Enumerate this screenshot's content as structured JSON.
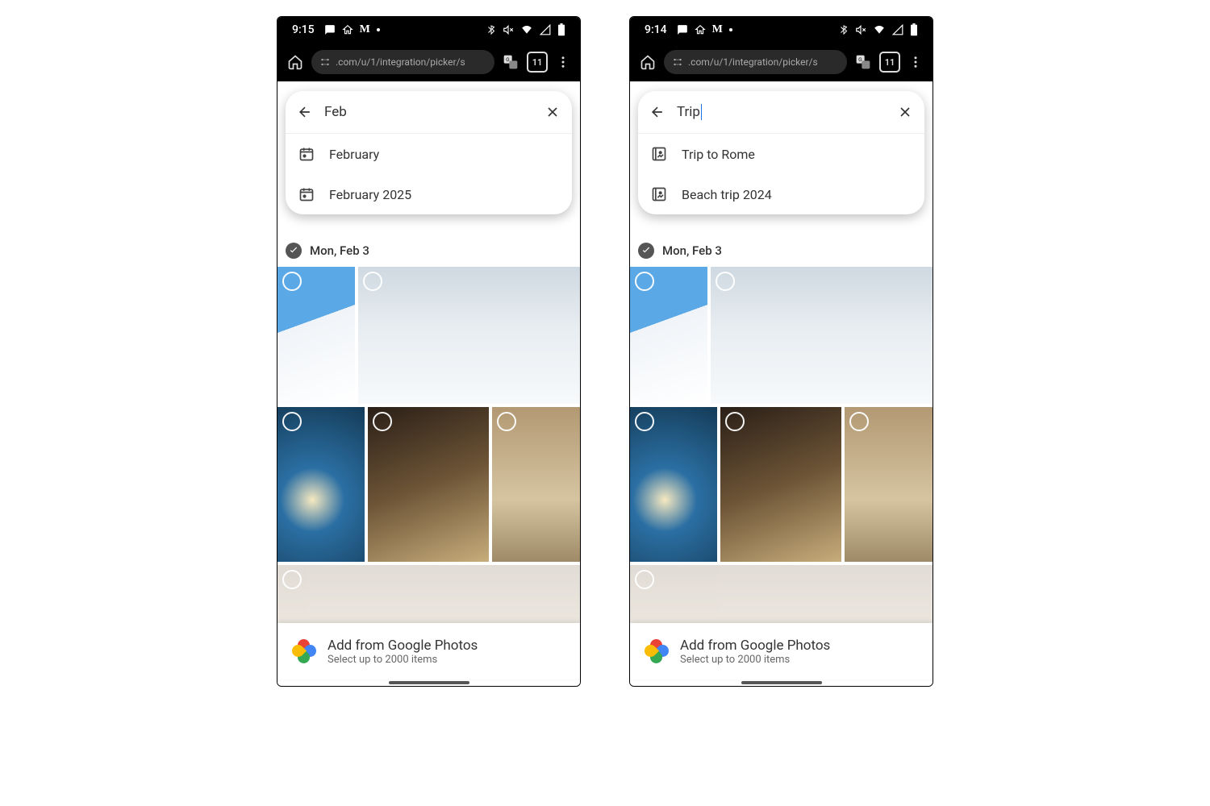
{
  "phones": [
    {
      "status": {
        "time": "9:15"
      },
      "browser": {
        "url_fragment": ".com/u/1/integration/picker/s",
        "tab_count": "11"
      },
      "search": {
        "query": "Feb",
        "show_cursor": false,
        "suggestions": [
          {
            "icon": "calendar",
            "label": "February"
          },
          {
            "icon": "calendar",
            "label": "February 2025"
          }
        ]
      },
      "date_header": "Mon, Feb 3",
      "bottom": {
        "title": "Add from Google Photos",
        "subtitle": "Select up to 2000 items"
      }
    },
    {
      "status": {
        "time": "9:14"
      },
      "browser": {
        "url_fragment": ".com/u/1/integration/picker/s",
        "tab_count": "11"
      },
      "search": {
        "query": "Trip",
        "show_cursor": true,
        "suggestions": [
          {
            "icon": "image",
            "label": "Trip to Rome"
          },
          {
            "icon": "image",
            "label": "Beach trip 2024"
          }
        ]
      },
      "date_header": "Mon, Feb 3",
      "bottom": {
        "title": "Add from Google Photos",
        "subtitle": "Select up to 2000 items"
      }
    }
  ]
}
